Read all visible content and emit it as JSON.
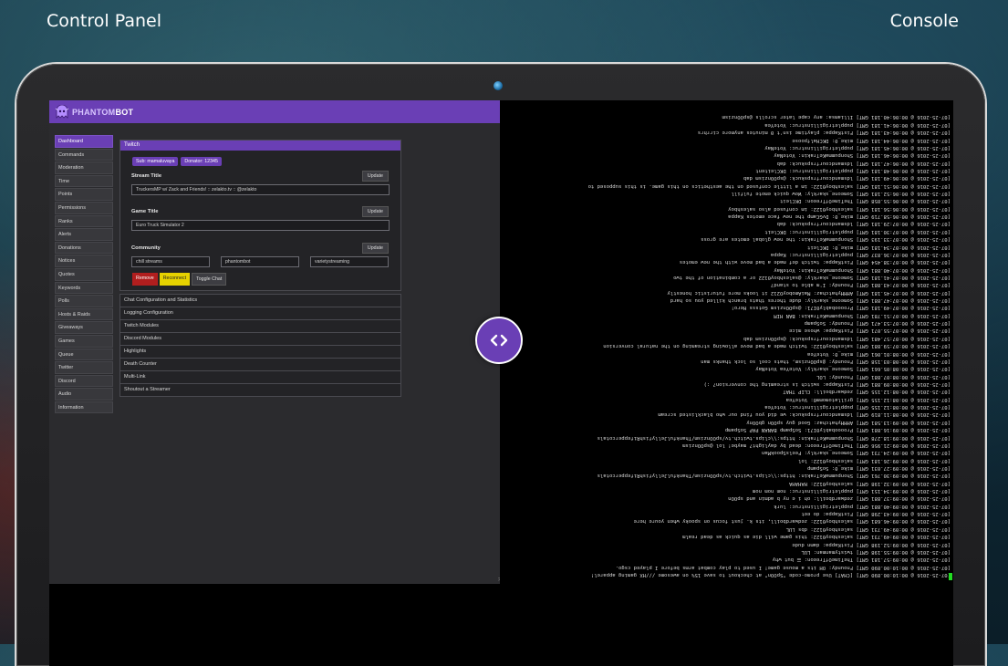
{
  "hero": {
    "left_title": "Control Panel",
    "right_title": "Console"
  },
  "app": {
    "logo_prefix": "PHANTOM",
    "logo_suffix": "BOT"
  },
  "sidebar": {
    "items": [
      "Dashboard",
      "Commands",
      "Moderation",
      "Time",
      "Points",
      "Permissions",
      "Ranks",
      "Alerts",
      "Donations",
      "Notices",
      "Quotes",
      "Keywords",
      "Polls",
      "Hosts & Raids",
      "Giveaways",
      "Games",
      "Queue",
      "Twitter",
      "Discord",
      "Audio",
      "Information"
    ]
  },
  "twitch": {
    "title": "Twitch",
    "sub_badge": "Sub: mamaluvaya",
    "donator_badge": "Donator: 12345",
    "stream_title_label": "Stream Title",
    "stream_title_value": "TruckersMP w/ Zack and Friends! :: zelakto.tv :: @zelakto",
    "game_title_label": "Game Title",
    "game_title_value": "Euro Truck Simulator 2",
    "community_label": "Community",
    "communities": [
      "chill streams",
      "phantombot",
      "varietystreaming"
    ],
    "update_label": "Update",
    "remove_label": "Remove",
    "reconnect_label": "Reconnect",
    "toggle_chat_label": "Toggle Chat"
  },
  "accordion": [
    "Chat Configuration and Statistics",
    "Logging Configuration",
    "Twitch Modules",
    "Discord Modules",
    "Highlights",
    "Death Counter",
    "Multi-Link",
    "Shoutout a Streamer"
  ],
  "console_prompt": ">",
  "console_lines": [
    "[07-25-2016 @ 00:10:00.890 GMT] [CHAT] Use promo-code \"SpOOn\" at checkout to save 15% on awesome ///HX gaming apparel!",
    "[07-25-2016 @ 00:10:00.890 GMT] Fnoundy: OH its a mouse game! I used to play combat arms before I played csgo.",
    "[07-25-2016 @ 00:09:57.181 GMT] TheTimeOfTreeon: ☰ but why",
    "[07-25-2016 @ 00:09:55.198 GMT] twistymanman: LUL",
    "[07-25-2016 @ 00:09:52.198 GMT] FistKappa: damn dude",
    "[07-25-2016 @ 00:09:49.731 GMT] saleshboy0122: this game will die as quick as dead realm",
    "[07-25-2016 @ 00:09:49.731 GMT] saleshboy0122: dbs LUL",
    "[07-25-2016 @ 00:09:46.681 GMT] saleshboy0122: zedwardboill, its k. just focus on spooky when youre here",
    "[07-25-2016 @ 00:09:43.298 GMT] FistKappa: do eet",
    "[07-25-2016 @ 00:09:40.881 GMT] puppletrigillinstruc: lurk",
    "[07-25-2016 @ 00:09:37.881 GMT] zedwardboill: oh i e ny b admin and spOOn",
    "[07-25-2016 @ 00:09:34.151 GMT] puppletrigillinstruc: nom nom nom",
    "[07-25-2016 @ 00:09:32.198 GMT] saleshboy0122: HAHAHA",
    "[07-25-2016 @ 00:09:30.761 GMT] ShonpummaKeTrakin: https:\\\\clips.twitch.tv/spOOnzism/ThankfulJellyfishRifeppercotals",
    "[07-25-2016 @ 00:09:27.031 GMT] mike_0: SoSpamp",
    "[07-25-2016 @ 00:09:26.181 GMT] saleshboy0122: lol",
    "[07-25-2016 @ 00:09:24.731 GMT] Someone_skarkly: FeelsSpookMan",
    "[07-25-2016 @ 00:09:21.956 GMT] TheTimeOfTreeon: dead by daylight? maybe! lol @spOOnzism",
    "[07-25-2016 @ 00:09:18.278 GMT] ShonpummaKeTrakin: https:\\\\clips.twitch.tv/spOOnzism/ThankfulJellyfishRifeppercotals",
    "[07-25-2016 @ 00:09:16.881 GMT] Proooobably0I71: SoSpamp BANAN PAP SoSpamp",
    "[07-25-2016 @ 00:09:13.581 GMT] AHHHyhatchaz: Good guy spOOn gbOOny",
    "[07-25-2016 @ 00:08:11.819 GMT] ldsmandcourfrspskuck: we did you find our who blacklisted scream",
    "[07-25-2016 @ 00:08:12.155 GMT] puppletrigillinstruc: VoteYea",
    "[07-25-2016 @ 00:08:12.155 GMT] grillatomomm0: VoteYea",
    "[07-25-2016 @ 00:08:12.155 GMT] zedwardboill: CLIP THAT",
    "[07-25-2016 @ 00:08:09.881 GMT] FistKappa: switch is streaming the conversion? :)",
    "[07-25-2016 @ 00:08:07.881 GMT] Fnoundy: LOL",
    "[07-25-2016 @ 00:08:05.661 GMT] Someone_skarkly: VoteYea VoteNay",
    "[07-25-2016 @ 00:08:03.158 GMT] Fnoundy: @spOOnzism, thats cool so lock thanks man",
    "[07-25-2016 @ 00:08:01.061 GMT] mike_0: VoteYea",
    "[07-25-2016 @ 00:07:59.881 GMT] saleshboy0122: twitch made a bad move allowing streaming on the natural conversion",
    "[07-25-2016 @ 00:07:57.481 GMT] ldsmandcourfrspskuck: @spOOnzism dab",
    "[07-25-2016 @ 00:07:55.071 GMT] FistKappa: whose mice",
    "[07-25-2016 @ 00:07:53.471 GMT] Fnoundy: SoSpamp",
    "[07-25-2016 @ 00:07:51.781 GMT] ShonpummaKeTrakin: BAN HIM",
    "[07-25-2016 @ 00:07:49.181 GMT] Proooobably0I71: @spOOnzism Gotsss Hero!",
    "[07-25-2016 @ 00:07:47.881 GMT] Someone_skarkly: dude theres thats branch killed you so hard",
    "[07-25-2016 @ 00:07:45.181 GMT] AHHHyhatchaz: MaiAmoboyO212 it looks more futuristic honestly",
    "[07-25-2016 @ 00:07:43.881 GMT] Fnoundy: I'm able to stand?",
    "[07-25-2016 @ 00:07:41.181 GMT] Someone_skarkly: @saleshboy0122 or a combination of the two",
    "[07-25-2016 @ 00:07:40.881 GMT] ShonpummaKeTrakin: VoteNay",
    "[07-25-2016 @ 00:07:38.454 GMT] FistKappa: twitch def made a bad move with the new emotes",
    "[07-25-2016 @ 00:07:36.837 GMT] puppletrigillinstruc: Kappa",
    "[07-25-2016 @ 00:07:34.181 GMT] mike_0: DKCleit",
    "[07-25-2016 @ 00:07:33.193 GMT] ShonpummaKeTrakin: the new global emotes are gross",
    "[07-25-2016 @ 00:07:30.181 GMT] puppletrigillinstruc: DKCleit",
    "[07-25-2016 @ 00:07:29.181 GMT] ldsmandcourfrspskuck: dab",
    "[07-25-2016 @ 00:06:58.719 GMT] mike_0: DvGCamp the new face emotes Kappa",
    "[07-25-2016 @ 00:06:56.181 GMT] saleshboy0122: im confused also saleshboy",
    "[07-25-2016 @ 00:06:55.058 GMT] TheTimeOfTreeon: DKCleit",
    "[07-25-2016 @ 00:06:52.181 GMT] Someone_skarkly: Wow quick emote fulfill",
    "[07-25-2016 @ 00:06:51.181 GMT] saleshboy0122: im a little confused on the aesthetics on this game. is this supposed to",
    "[07-25-2016 @ 00:06:49.181 GMT] ldsmandcourfrspskuck: @spOOnzism dab",
    "[07-25-2016 @ 00:06:48.181 GMT] puppletrigillinstruc: DKCleitent",
    "[07-25-2016 @ 00:06:47.181 GMT] ldsmandcourfrspskuck: dab",
    "[07-25-2016 @ 00:06:46.181 GMT] ShonpummaKeTrakin: VoteNay",
    "[07-25-2016 @ 00:06:45.181 GMT] puppletrigillinstruc: VoteNay",
    "[07-25-2016 @ 00:06:44.181 GMT] mike_0: DKCHalfpoose",
    "[07-25-2016 @ 00:06:43.181 GMT] FistKappa: playtime isn't 0 minutes anymore cirrhrs",
    "[07-25-2016 @ 00:06:41.181 GMT] puppletrigillinstruc: VoteYea",
    "[07-25-2016 @ 00:06:40.181 GMT] Illiamsa: any cape later scrolls @spOOnzism"
  ]
}
